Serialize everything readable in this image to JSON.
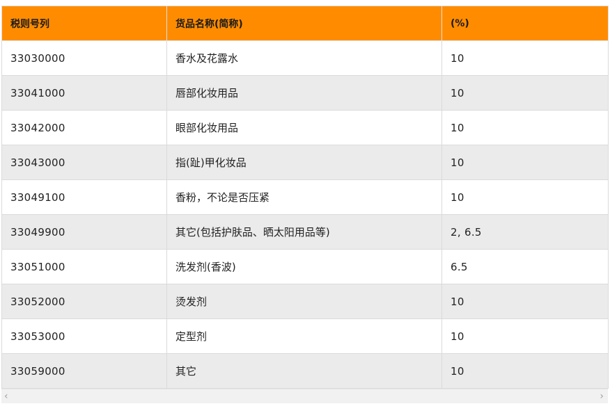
{
  "table": {
    "headers": [
      "税则号列",
      "货品名称(简称)",
      "(%)"
    ],
    "rows": [
      {
        "code": "33030000",
        "name": "香水及花露水",
        "rate": "10"
      },
      {
        "code": "33041000",
        "name": "唇部化妆用品",
        "rate": "10"
      },
      {
        "code": "33042000",
        "name": "眼部化妆用品",
        "rate": "10"
      },
      {
        "code": "33043000",
        "name": "指(趾)甲化妆品",
        "rate": "10"
      },
      {
        "code": "33049100",
        "name": "香粉，不论是否压紧",
        "rate": "10"
      },
      {
        "code": "33049900",
        "name": "其它(包括护肤品、晒太阳用品等)",
        "rate": "2, 6.5"
      },
      {
        "code": "33051000",
        "name": "洗发剂(香波)",
        "rate": "6.5"
      },
      {
        "code": "33052000",
        "name": "烫发剂",
        "rate": "10"
      },
      {
        "code": "33053000",
        "name": "定型剂",
        "rate": "10"
      },
      {
        "code": "33059000",
        "name": "其它",
        "rate": "10"
      }
    ]
  },
  "scrollbar": {
    "left_arrow": "‹",
    "right_arrow": "›"
  },
  "colors": {
    "header_bg": "#ff8c00",
    "row_alt_bg": "#ebebeb"
  }
}
